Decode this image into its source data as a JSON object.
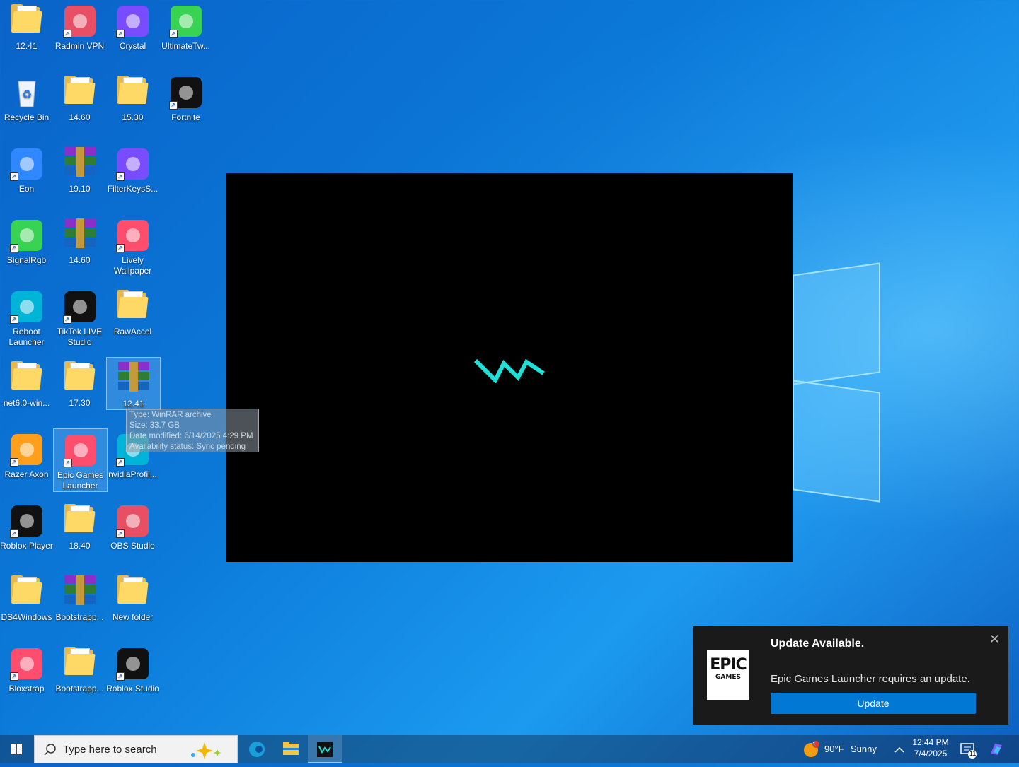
{
  "desktop_icons": [
    {
      "label": "12.41",
      "type": "folder"
    },
    {
      "label": "Radmin VPN",
      "type": "app"
    },
    {
      "label": "Crystal",
      "type": "app"
    },
    {
      "label": "UltimateTw...",
      "type": "app"
    },
    {
      "label": "Recycle Bin",
      "type": "recycle"
    },
    {
      "label": "14.60",
      "type": "folder"
    },
    {
      "label": "15.30",
      "type": "folder"
    },
    {
      "label": "Fortnite",
      "type": "app"
    },
    {
      "label": "Eon",
      "type": "app"
    },
    {
      "label": "19.10",
      "type": "rar"
    },
    {
      "label": "FilterKeysS...",
      "type": "app"
    },
    {
      "label": "SignalRgb",
      "type": "app"
    },
    {
      "label": "14.60",
      "type": "rar"
    },
    {
      "label": "Lively Wallpaper",
      "type": "app"
    },
    {
      "label": "Reboot Launcher",
      "type": "app"
    },
    {
      "label": "TikTok LIVE Studio",
      "type": "app"
    },
    {
      "label": "RawAccel",
      "type": "folder"
    },
    {
      "label": "net6.0-win...",
      "type": "folder"
    },
    {
      "label": "17.30",
      "type": "folder"
    },
    {
      "label": "12.41",
      "type": "rar"
    },
    {
      "label": "Razer Axon",
      "type": "app"
    },
    {
      "label": "Epic Games Launcher",
      "type": "app"
    },
    {
      "label": "nvidiaProfil...",
      "type": "app"
    },
    {
      "label": "Roblox Player",
      "type": "app"
    },
    {
      "label": "18.40",
      "type": "folder"
    },
    {
      "label": "OBS Studio",
      "type": "app"
    },
    {
      "label": "DS4Windows",
      "type": "folder"
    },
    {
      "label": "Bootstrapp...",
      "type": "rar"
    },
    {
      "label": "New folder",
      "type": "folder"
    },
    {
      "label": "Bloxstrap",
      "type": "app"
    },
    {
      "label": "Bootstrapp...",
      "type": "folder"
    },
    {
      "label": "Roblox Studio",
      "type": "app"
    }
  ],
  "tooltip": {
    "type": "Type: WinRAR archive",
    "size": "Size: 33.7 GB",
    "date": "Date modified: 6/14/2025 4:29 PM",
    "availability": "Availability status: Sync pending"
  },
  "vm_window": {
    "logo_text": "VM"
  },
  "toast": {
    "logo_line1": "EPIC",
    "logo_line2": "GAMES",
    "title": "Update Available.",
    "message": "Epic Games Launcher requires an update.",
    "button": "Update",
    "close": "✕"
  },
  "taskbar": {
    "search_placeholder": "Type here to search",
    "weather_temp": "90°F",
    "weather_desc": "Sunny",
    "weather_badge": "1",
    "time": "12:44 PM",
    "date": "7/4/2025",
    "notification_count": "11"
  },
  "colors": {
    "accent": "#0078d4",
    "vm_logo": "#1fe0d6"
  }
}
